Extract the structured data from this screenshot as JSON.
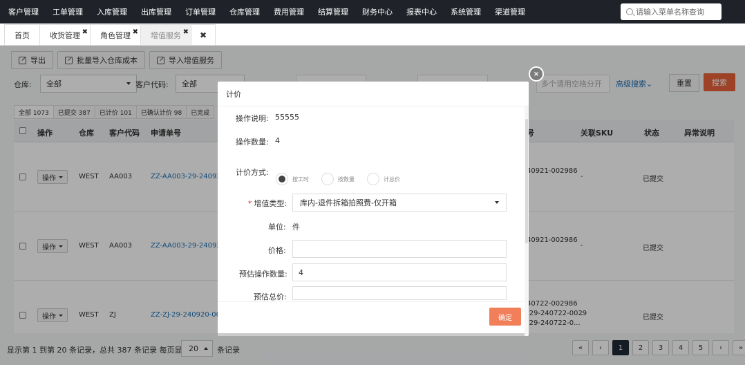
{
  "topnav": {
    "items": [
      "客户管理",
      "工单管理",
      "入库管理",
      "出库管理",
      "订单管理",
      "仓库管理",
      "费用管理",
      "结算管理",
      "财务中心",
      "报表中心",
      "系统管理",
      "渠道管理"
    ],
    "search_placeholder": "请输入菜单名称查询"
  },
  "tabs": [
    {
      "label": "首页",
      "closable": false
    },
    {
      "label": "收货管理",
      "closable": true
    },
    {
      "label": "角色管理",
      "closable": true
    },
    {
      "label": "增值服务",
      "closable": true,
      "active": true
    }
  ],
  "tab_close_all": "✖",
  "toolbar": {
    "export": "导出",
    "batch_import": "批量导入仓库成本",
    "import_vas": "导入增值服务"
  },
  "filters": {
    "warehouse_label": "仓库:",
    "warehouse_value": "全部",
    "customer_label": "客户代码:",
    "customer_value": "全部",
    "related_placeholder": "多个请用空格分开",
    "advanced": "高级搜索",
    "reset": "重置",
    "search": "搜索"
  },
  "status_tabs": [
    "全部 1073",
    "已提交 387",
    "已计价 101",
    "已确认计价 98",
    "已完成"
  ],
  "table": {
    "headers": {
      "operation": "操作",
      "warehouse": "仓库",
      "customer": "客户代码",
      "apply_no": "申请单号",
      "ref_no": "号",
      "sku": "关联SKU",
      "status": "状态",
      "exception": "异常说明"
    },
    "op_label": "操作",
    "rows": [
      {
        "warehouse": "WEST",
        "customer": "AA003",
        "apply_no": "ZZ-AA003-29-240921-",
        "ref": [
          "40921-002986"
        ],
        "sku": "-",
        "status": "已提交"
      },
      {
        "warehouse": "WEST",
        "customer": "AA003",
        "apply_no": "ZZ-AA003-29-240921-",
        "ref": [
          "40921-002986"
        ],
        "sku": "-",
        "status": "已提交"
      },
      {
        "warehouse": "WEST",
        "customer": "ZJ",
        "apply_no": "ZZ-ZJ-29-240920-0007",
        "ref": [
          "40722-002986",
          "-29-240722-0029",
          "-29-240722-0..."
        ],
        "sku": "-",
        "status": "已提交"
      }
    ]
  },
  "pager": {
    "summary": "显示第 1 到第 20 条记录，总共 387 条记录 每页显示",
    "page_size": "20",
    "suffix": "条记录",
    "buttons": [
      "«",
      "‹",
      "1",
      "2",
      "3",
      "4",
      "5",
      "›",
      "»"
    ],
    "active": "1"
  },
  "modal": {
    "title": "计价",
    "op_desc_label": "操作说明:",
    "op_desc_value": "55555",
    "op_qty_label": "操作数量:",
    "op_qty_value": "4",
    "pricing_label": "计价方式:",
    "pricing_options": [
      "按工时",
      "按数量",
      "计总价"
    ],
    "vas_type_label": "增值类型:",
    "vas_type_value": "库内-退件拆箱拍照费-仅开箱",
    "unit_label": "单位:",
    "unit_value": "件",
    "price_label": "价格:",
    "price_value": "",
    "est_qty_label": "预估操作数量:",
    "est_qty_value": "4",
    "est_total_label": "预估总价:",
    "est_total_value": "",
    "confirm": "确定"
  }
}
